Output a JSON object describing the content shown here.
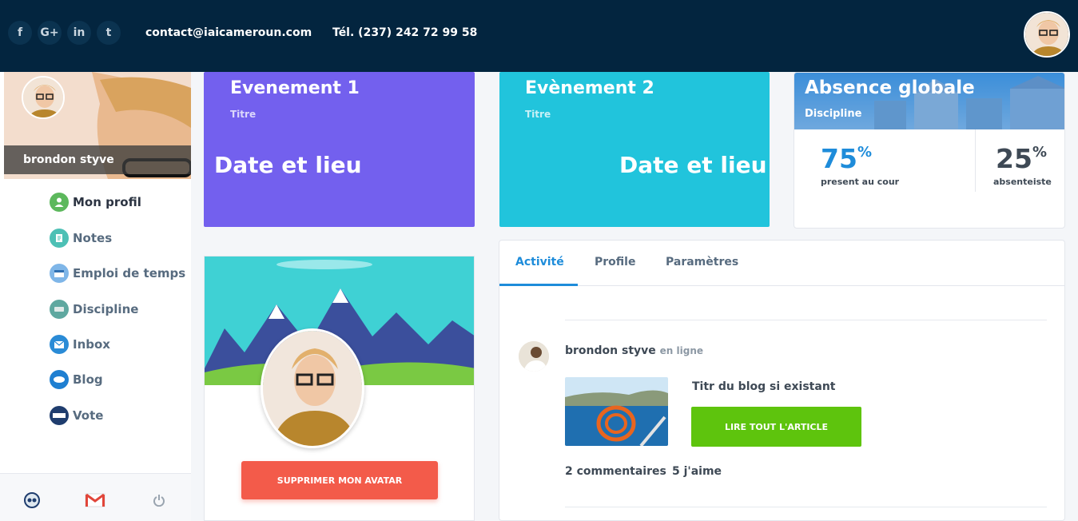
{
  "topbar": {
    "social": [
      {
        "icon": "facebook-icon",
        "glyph": "f"
      },
      {
        "icon": "google-plus-icon",
        "glyph": "G+"
      },
      {
        "icon": "linkedin-icon",
        "glyph": "in"
      },
      {
        "icon": "twitter-icon",
        "glyph": "t"
      }
    ],
    "email": "contact@iaicameroun.com",
    "phone": "Tél. (237) 242 72 99 58"
  },
  "sidebar": {
    "user_name": "brondon styve",
    "items": [
      {
        "label": "Mon profil",
        "icon": "user-icon",
        "color": "#5cb85c"
      },
      {
        "label": "Notes",
        "icon": "notes-icon",
        "color": "#4dc0b5"
      },
      {
        "label": "Emploi de temps",
        "icon": "calendar-icon",
        "color": "#7fb6e8"
      },
      {
        "label": "Discipline",
        "icon": "discipline-icon",
        "color": "#5fa8a0"
      },
      {
        "label": "Inbox",
        "icon": "inbox-icon",
        "color": "#2a8bd6"
      },
      {
        "label": "Blog",
        "icon": "blog-icon",
        "color": "#1f7fd1"
      },
      {
        "label": "Vote",
        "icon": "vote-icon",
        "color": "#1f3d6e"
      }
    ],
    "footer": [
      {
        "icon": "settings-icon"
      },
      {
        "icon": "gmail-icon"
      },
      {
        "icon": "power-icon"
      }
    ]
  },
  "events": [
    {
      "title": "Evenement 1",
      "subtitle": "Titre",
      "date_place": "Date et lieu",
      "color": "#7360ee"
    },
    {
      "title": "Evènement 2",
      "subtitle": "Titre",
      "date_place": "Date et lieu",
      "color": "#21c4dc"
    }
  ],
  "absence": {
    "title": "Absence globale",
    "subtitle": "Discipline",
    "present": {
      "value": "75",
      "unit": "%",
      "label": "present au cour",
      "color": "#1e8cda"
    },
    "absent": {
      "value": "25",
      "unit": "%",
      "label": "absenteiste",
      "color": "#3e4955"
    }
  },
  "avatar_panel": {
    "delete_label": "SUPPRIMER MON AVATAR"
  },
  "activity": {
    "tabs": [
      "Activité",
      "Profile",
      "Paramètres"
    ],
    "post": {
      "author": "brondon styve",
      "status": "en ligne",
      "blog_title": "Titr du blog si existant",
      "read_label": "LIRE TOUT L'ARTICLE",
      "comments": "2 commentaires",
      "likes": "5 j'aime"
    }
  },
  "colors": {
    "topbar": "#03253f",
    "accent": "#1e8cda",
    "danger": "#f35b4a",
    "success": "#5ec40d"
  }
}
